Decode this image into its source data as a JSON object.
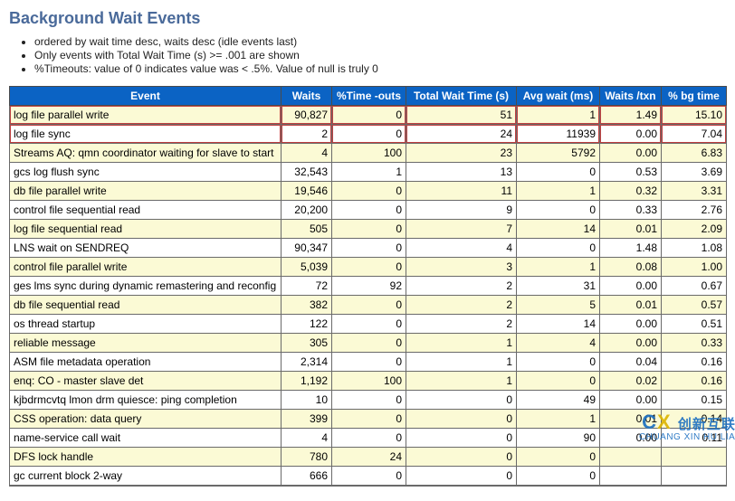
{
  "title": "Background Wait Events",
  "notes": [
    "ordered by wait time desc, waits desc (idle events last)",
    "Only events with Total Wait Time (s) >= .001 are shown",
    "%Timeouts: value of 0 indicates value was < .5%. Value of null is truly 0"
  ],
  "columns": [
    "Event",
    "Waits",
    "%Time -outs",
    "Total Wait Time (s)",
    "Avg wait (ms)",
    "Waits /txn",
    "% bg time"
  ],
  "rows": [
    {
      "event": "log file parallel write",
      "waits": "90,827",
      "timeouts": "0",
      "total": "51",
      "avg": "1",
      "wtxn": "1.49",
      "bg": "15.10",
      "hl": true
    },
    {
      "event": "log file sync",
      "waits": "2",
      "timeouts": "0",
      "total": "24",
      "avg": "11939",
      "wtxn": "0.00",
      "bg": "7.04",
      "hl": true
    },
    {
      "event": "Streams AQ: qmn coordinator waiting for slave to start",
      "waits": "4",
      "timeouts": "100",
      "total": "23",
      "avg": "5792",
      "wtxn": "0.00",
      "bg": "6.83"
    },
    {
      "event": "gcs log flush sync",
      "waits": "32,543",
      "timeouts": "1",
      "total": "13",
      "avg": "0",
      "wtxn": "0.53",
      "bg": "3.69"
    },
    {
      "event": "db file parallel write",
      "waits": "19,546",
      "timeouts": "0",
      "total": "11",
      "avg": "1",
      "wtxn": "0.32",
      "bg": "3.31"
    },
    {
      "event": "control file sequential read",
      "waits": "20,200",
      "timeouts": "0",
      "total": "9",
      "avg": "0",
      "wtxn": "0.33",
      "bg": "2.76"
    },
    {
      "event": "log file sequential read",
      "waits": "505",
      "timeouts": "0",
      "total": "7",
      "avg": "14",
      "wtxn": "0.01",
      "bg": "2.09"
    },
    {
      "event": "LNS wait on SENDREQ",
      "waits": "90,347",
      "timeouts": "0",
      "total": "4",
      "avg": "0",
      "wtxn": "1.48",
      "bg": "1.08"
    },
    {
      "event": "control file parallel write",
      "waits": "5,039",
      "timeouts": "0",
      "total": "3",
      "avg": "1",
      "wtxn": "0.08",
      "bg": "1.00"
    },
    {
      "event": "ges lms sync during dynamic remastering and reconfig",
      "waits": "72",
      "timeouts": "92",
      "total": "2",
      "avg": "31",
      "wtxn": "0.00",
      "bg": "0.67"
    },
    {
      "event": "db file sequential read",
      "waits": "382",
      "timeouts": "0",
      "total": "2",
      "avg": "5",
      "wtxn": "0.01",
      "bg": "0.57"
    },
    {
      "event": "os thread startup",
      "waits": "122",
      "timeouts": "0",
      "total": "2",
      "avg": "14",
      "wtxn": "0.00",
      "bg": "0.51"
    },
    {
      "event": "reliable message",
      "waits": "305",
      "timeouts": "0",
      "total": "1",
      "avg": "4",
      "wtxn": "0.00",
      "bg": "0.33"
    },
    {
      "event": "ASM file metadata operation",
      "waits": "2,314",
      "timeouts": "0",
      "total": "1",
      "avg": "0",
      "wtxn": "0.04",
      "bg": "0.16"
    },
    {
      "event": "enq: CO - master slave det",
      "waits": "1,192",
      "timeouts": "100",
      "total": "1",
      "avg": "0",
      "wtxn": "0.02",
      "bg": "0.16"
    },
    {
      "event": "kjbdrmcvtq lmon drm quiesce: ping completion",
      "waits": "10",
      "timeouts": "0",
      "total": "0",
      "avg": "49",
      "wtxn": "0.00",
      "bg": "0.15"
    },
    {
      "event": "CSS operation: data query",
      "waits": "399",
      "timeouts": "0",
      "total": "0",
      "avg": "1",
      "wtxn": "0.01",
      "bg": "0.14"
    },
    {
      "event": "name-service call wait",
      "waits": "4",
      "timeouts": "0",
      "total": "0",
      "avg": "90",
      "wtxn": "0.00",
      "bg": "0.11"
    },
    {
      "event": "DFS lock handle",
      "waits": "780",
      "timeouts": "24",
      "total": "0",
      "avg": "0",
      "wtxn": "",
      "bg": ""
    },
    {
      "event": "gc current block 2-way",
      "waits": "666",
      "timeouts": "0",
      "total": "0",
      "avg": "0",
      "wtxn": "",
      "bg": ""
    }
  ],
  "watermark": {
    "line1_left": "C",
    "line1_accent": "X",
    "line2": "创新互联",
    "sub": "CHUANG XIN HU LIAN"
  }
}
